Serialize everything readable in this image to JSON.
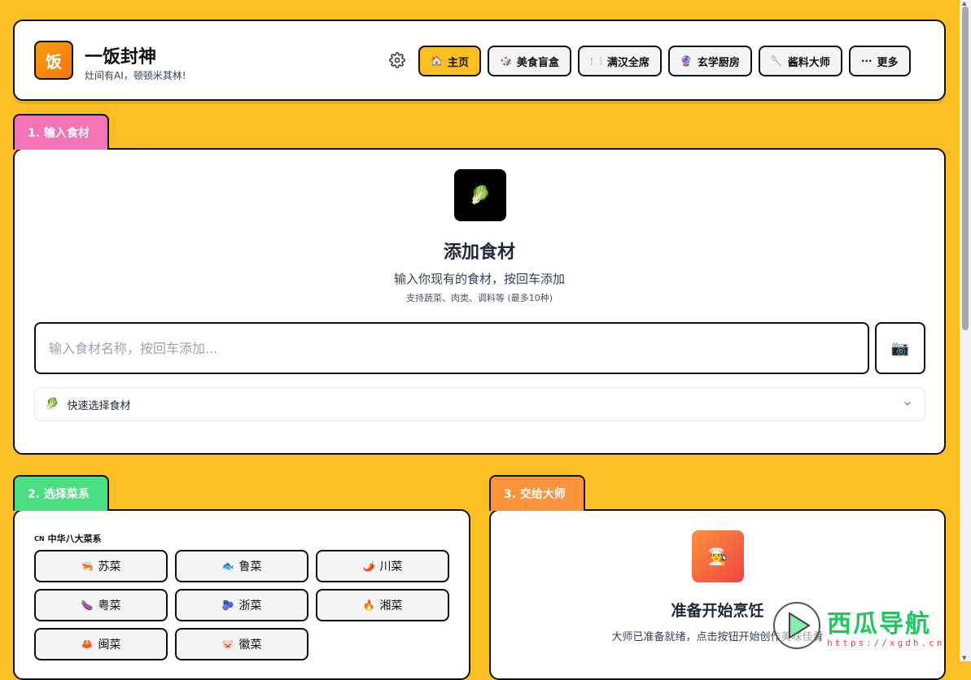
{
  "header": {
    "logo_char": "饭",
    "title": "一饭封神",
    "subtitle": "灶间有AI，顿顿米其林!",
    "settings_icon": "gear-icon",
    "nav": [
      {
        "icon": "🏠",
        "label": "主页",
        "active": true
      },
      {
        "icon": "🎲",
        "label": "美食盲盒"
      },
      {
        "icon": "🍽️",
        "label": "满汉全席"
      },
      {
        "icon": "🔮",
        "label": "玄学厨房"
      },
      {
        "icon": "🥄",
        "label": "酱料大师"
      },
      {
        "icon": "···",
        "label": "更多"
      }
    ]
  },
  "section1": {
    "tab": "1. 输入食材",
    "icon": "🥬",
    "title": "添加食材",
    "desc": "输入你现有的食材，按回车添加",
    "hint": "支持蔬菜、肉类、调料等 (最多10种)",
    "input_placeholder": "输入食材名称，按回车添加...",
    "camera_icon": "📷",
    "quick_icon": "🥬",
    "quick_label": "快速选择食材"
  },
  "section2": {
    "tab": "2. 选择菜系",
    "group_flag": "CN",
    "group_label": "中华八大菜系",
    "cuisines": [
      {
        "icon": "🦐",
        "label": "苏菜"
      },
      {
        "icon": "🐟",
        "label": "鲁菜"
      },
      {
        "icon": "🌶️",
        "label": "川菜"
      },
      {
        "icon": "🍆",
        "label": "粤菜"
      },
      {
        "icon": "🫐",
        "label": "浙菜"
      },
      {
        "icon": "🔥",
        "label": "湘菜"
      },
      {
        "icon": "🦀",
        "label": "闽菜"
      },
      {
        "icon": "🐷",
        "label": "徽菜"
      }
    ]
  },
  "section3": {
    "tab": "3. 交给大师",
    "icon": "👨‍🍳",
    "title": "准备开始烹饪",
    "desc": "大师已准备就绪，点击按钮开始创作美味佳肴"
  },
  "watermark": {
    "text": "西瓜导航",
    "url": "https://xgdh.cn"
  }
}
